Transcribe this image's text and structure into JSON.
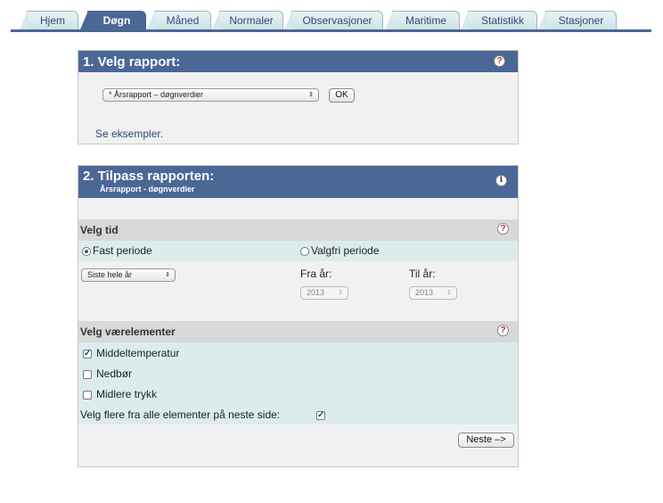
{
  "tabs": [
    {
      "label": "Hjem"
    },
    {
      "label": "Døgn"
    },
    {
      "label": "Måned"
    },
    {
      "label": "Normaler"
    },
    {
      "label": "Observasjoner"
    },
    {
      "label": "Maritime"
    },
    {
      "label": "Statistikk"
    },
    {
      "label": "Stasjoner"
    }
  ],
  "active_tab": "Døgn",
  "panel1": {
    "title": "1. Velg rapport:",
    "report_select": "* Årsrapport – døgnverdier",
    "ok_label": "OK",
    "examples_link": "Se eksempler."
  },
  "panel2": {
    "title": "2. Tilpass rapporten:",
    "subtitle": "Årsrapport - døgnverdier",
    "time_section": {
      "title": "Velg tid",
      "fixed_label": "Fast periode",
      "free_label": "Valgfri periode",
      "fixed_selected": true,
      "period_select": "Siste hele år",
      "from_label": "Fra år:",
      "to_label": "Til år:",
      "from_value": "2013",
      "to_value": "2013"
    },
    "elements_section": {
      "title": "Velg værelementer",
      "items": [
        {
          "label": "Middeltemperatur",
          "checked": true
        },
        {
          "label": "Nedbør",
          "checked": false
        },
        {
          "label": "Midlere trykk",
          "checked": false
        }
      ],
      "more_label": "Velg flere fra alle elementer på neste side:",
      "more_checked": true
    },
    "next_label": "Neste –>"
  },
  "colors": {
    "header_blue": "#4a6796",
    "row_teal": "#dcecec",
    "section_grey": "#d8d8d8",
    "help_red": "#c0302a"
  }
}
